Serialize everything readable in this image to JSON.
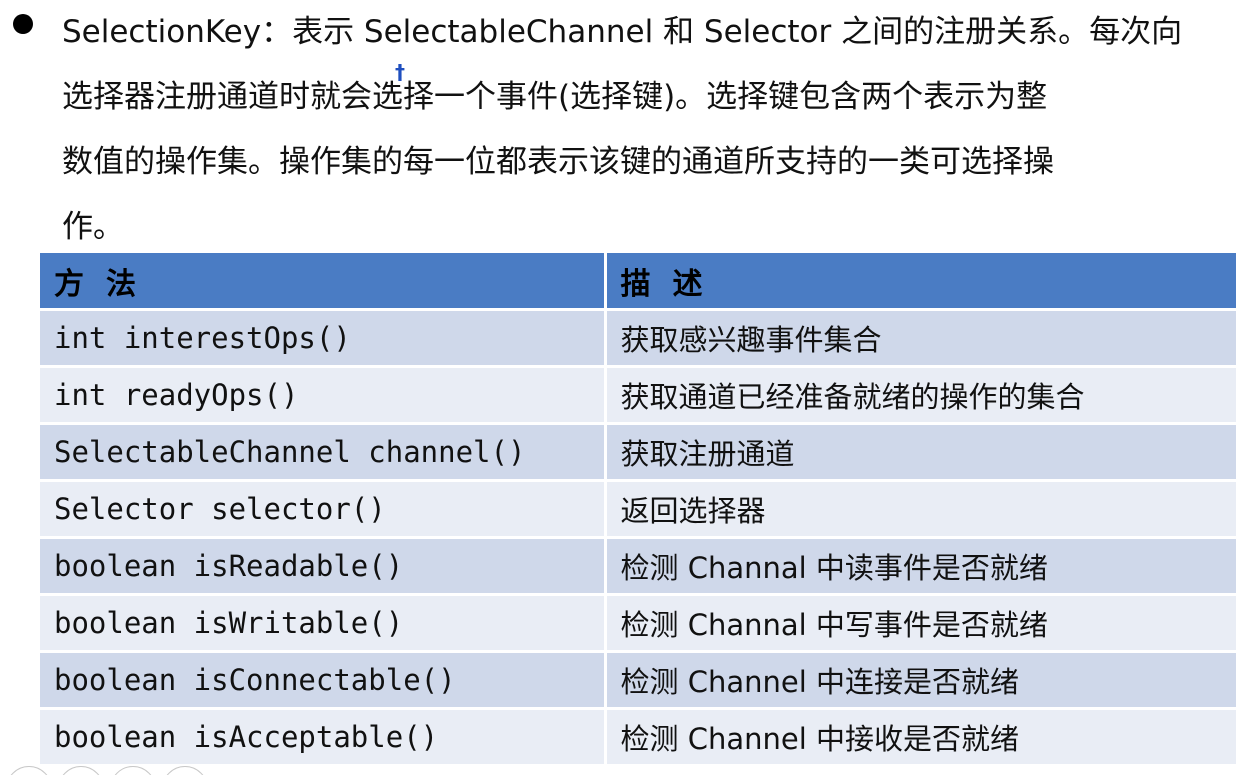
{
  "intro": {
    "lines": [
      "SelectionKey：表示 SelectableChannel 和 Selector 之间的注册关系。每次向",
      "选择器注册通道时就会选择一个事件(选择键)。选择键包含两个表示为整",
      "数值的操作集。操作集的每一位都表示该键的通道所支持的一类可选择操",
      "作。"
    ]
  },
  "table": {
    "headers": [
      "方法",
      "描述"
    ],
    "rows": [
      {
        "method": "int   interestOps()",
        "description": "获取感兴趣事件集合"
      },
      {
        "method": "int   readyOps()",
        "description": "获取通道已经准备就绪的操作的集合"
      },
      {
        "method": "SelectableChannel  channel()",
        "description": "获取注册通道"
      },
      {
        "method": "Selector  selector()",
        "description": "返回选择器"
      },
      {
        "method": "boolean isReadable()",
        "description": "检测 Channal 中读事件是否就绪"
      },
      {
        "method": "boolean isWritable()",
        "description": "检测 Channal 中写事件是否就绪"
      },
      {
        "method": "boolean isConnectable()",
        "description": "检测 Channel 中连接是否就绪"
      },
      {
        "method": "boolean isAcceptable()",
        "description": "检测 Channel 中接收是否就绪"
      }
    ]
  },
  "colors": {
    "header_bg": "#4a7cc4",
    "row_odd": "#cfd8ea",
    "row_even": "#e9edf5"
  }
}
